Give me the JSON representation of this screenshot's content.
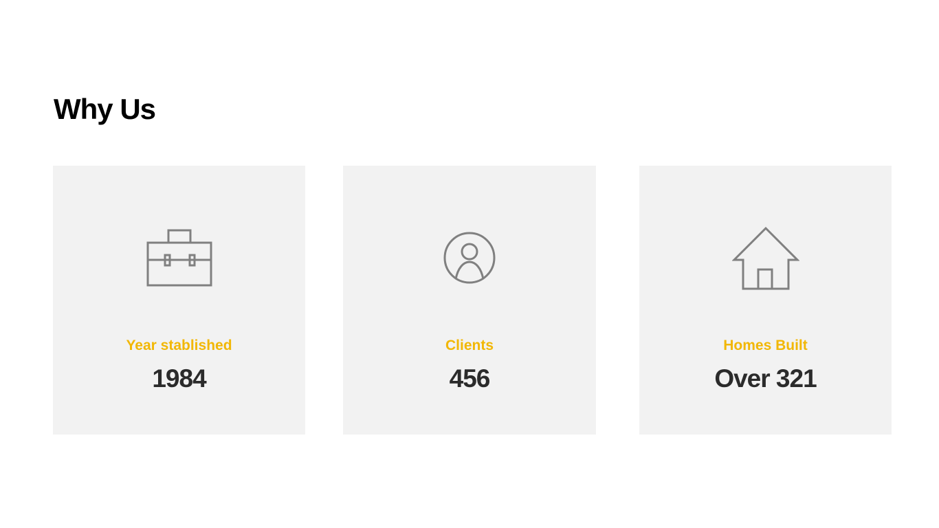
{
  "section": {
    "title": "Why Us"
  },
  "colors": {
    "accent": "#f2b705",
    "card_background": "#f2f2f2",
    "icon_stroke": "#808080",
    "value_text": "#2b2b2b"
  },
  "stats": [
    {
      "icon": "briefcase-icon",
      "label": "Year stablished",
      "value": "1984"
    },
    {
      "icon": "user-circle-icon",
      "label": "Clients",
      "value": "456"
    },
    {
      "icon": "house-icon",
      "label": "Homes Built",
      "value": "Over 321"
    }
  ]
}
